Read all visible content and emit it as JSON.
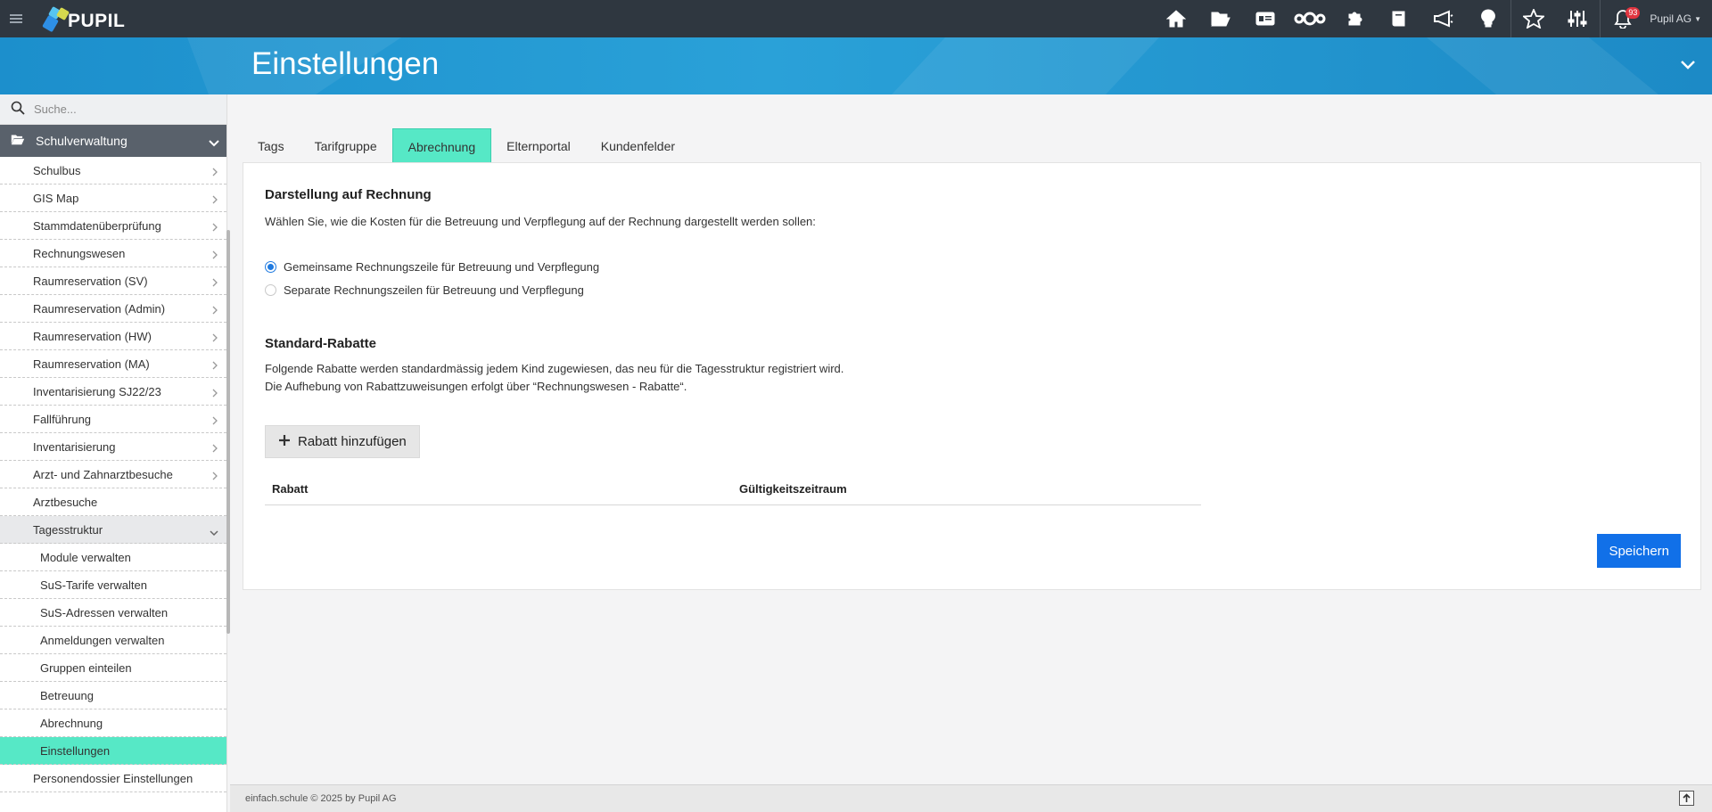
{
  "app": {
    "logo_text": "PUPIL",
    "user": "Pupil AG",
    "notification_count": "93"
  },
  "header": {
    "title": "Einstellungen"
  },
  "search": {
    "placeholder": "Suche..."
  },
  "sidebar": {
    "section_label": "Schulverwaltung",
    "items": [
      "Schulbus",
      "GIS Map",
      "Stammdatenüberprüfung",
      "Rechnungswesen",
      "Raumreservation (SV)",
      "Raumreservation (Admin)",
      "Raumreservation (HW)",
      "Raumreservation (MA)",
      "Inventarisierung SJ22/23",
      "Fallführung",
      "Inventarisierung",
      "Arzt- und Zahnarztbesuche",
      "Arztbesuche",
      "Tagesstruktur"
    ],
    "subitems": [
      "Module verwalten",
      "SuS-Tarife verwalten",
      "SuS-Adressen verwalten",
      "Anmeldungen verwalten",
      "Gruppen einteilen",
      "Betreuung",
      "Abrechnung",
      "Einstellungen"
    ],
    "after_items": [
      "Personendossier Einstellungen"
    ]
  },
  "tabs": [
    "Tags",
    "Tarifgruppe",
    "Abrechnung",
    "Elternportal",
    "Kundenfelder"
  ],
  "main": {
    "section1_title": "Darstellung auf Rechnung",
    "section1_desc": "Wählen Sie, wie die Kosten für die Betreuung und Verpflegung auf der Rechnung dargestellt werden sollen:",
    "radio_options": [
      "Gemeinsame Rechnungszeile für Betreuung und Verpflegung",
      "Separate Rechnungszeilen für Betreuung und Verpflegung"
    ],
    "section2_title": "Standard-Rabatte",
    "section2_desc1": "Folgende Rabatte werden standardmässig jedem Kind zugewiesen, das neu für die Tagesstruktur registriert wird.",
    "section2_desc2": "Die Aufhebung von Rabattzuweisungen erfolgt über “Rechnungswesen - Rabatte“.",
    "add_button": "Rabatt hinzufügen",
    "table_headers": [
      "Rabatt",
      "Gültigkeitszeitraum"
    ],
    "save_button": "Speichern"
  },
  "footer": {
    "text": "einfach.schule © 2025 by Pupil AG"
  },
  "colors": {
    "accent": "#56e8c6",
    "primary": "#1170e8",
    "topbar": "#2f3740",
    "banner": "#2aa1d8"
  }
}
